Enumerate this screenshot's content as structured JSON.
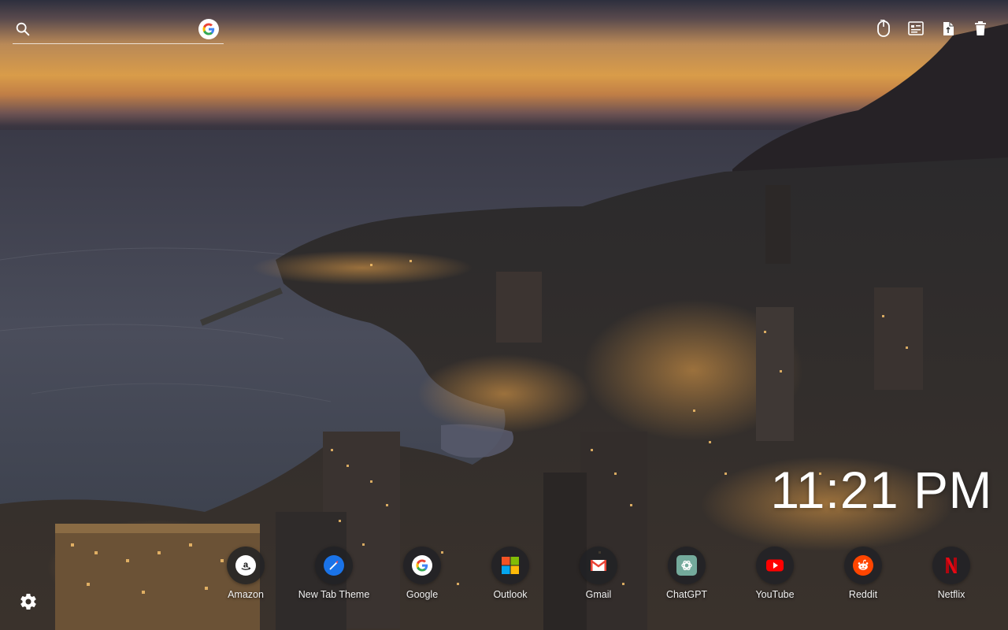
{
  "search": {
    "placeholder": "",
    "value": "",
    "engine_icon": "google-icon"
  },
  "toolbar": {
    "icons": [
      "mouse-icon",
      "screenshot-icon",
      "clipboard-icon",
      "trash-icon"
    ]
  },
  "clock": {
    "time": "11:21 PM"
  },
  "shortcuts": [
    {
      "label": "Amazon",
      "icon": "amazon-icon"
    },
    {
      "label": "New Tab Theme",
      "icon": "new-tab-theme-icon"
    },
    {
      "label": "Google",
      "icon": "google-icon"
    },
    {
      "label": "Outlook",
      "icon": "outlook-icon"
    },
    {
      "label": "Gmail",
      "icon": "gmail-icon"
    },
    {
      "label": "ChatGPT",
      "icon": "chatgpt-icon"
    },
    {
      "label": "YouTube",
      "icon": "youtube-icon"
    },
    {
      "label": "Reddit",
      "icon": "reddit-icon"
    },
    {
      "label": "Netflix",
      "icon": "netflix-icon"
    }
  ],
  "settings": {
    "icon": "gear-icon"
  },
  "colors": {
    "tile_bg": "#202124",
    "youtube": "#ff0000",
    "reddit": "#ff4500",
    "netflix": "#e50914",
    "chatgpt": "#74aa9c",
    "outlook_red": "#f35325",
    "outlook_green": "#81bc06",
    "outlook_blue": "#05a6f0",
    "outlook_yellow": "#ffba08"
  }
}
